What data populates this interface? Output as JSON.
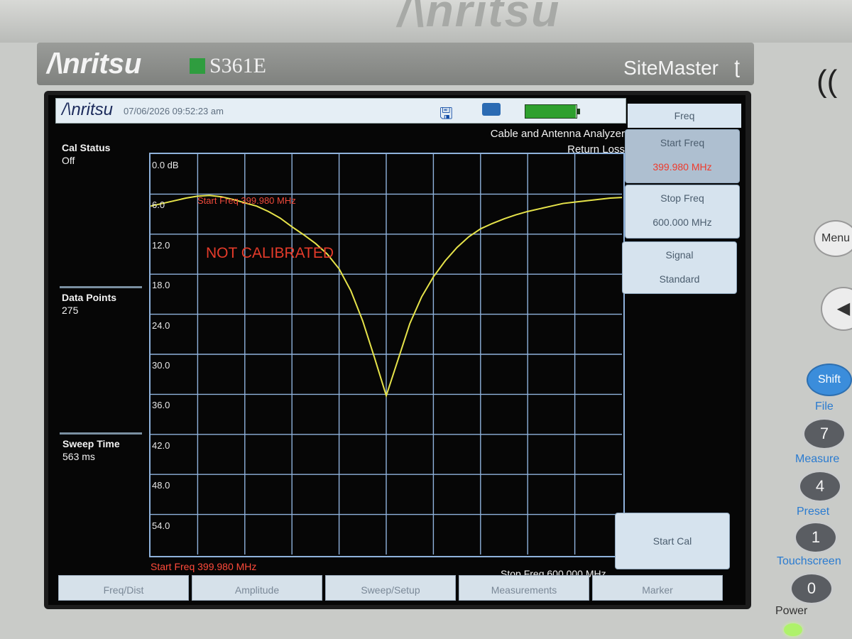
{
  "device": {
    "top_logo": "/\\nritsu",
    "brand": "/\\nritsu",
    "model": "S361E",
    "product": "SiteMaster"
  },
  "status_bar": {
    "logo": "/\\nritsu",
    "datetime": "07/06/2026 09:52:23 am",
    "battery_level": 0.98
  },
  "mode": {
    "line1": "Cable and Antenna Analyzer",
    "line2": "Return Loss"
  },
  "left_panel": {
    "cal_status_label": "Cal Status",
    "cal_status_value": "Off",
    "data_points_label": "Data Points",
    "data_points_value": "275",
    "sweep_time_label": "Sweep Time",
    "sweep_time_value": "563 ms"
  },
  "graph": {
    "y_labels": [
      "0.0 dB",
      "6.0",
      "12.0",
      "18.0",
      "24.0",
      "30.0",
      "36.0",
      "42.0",
      "48.0",
      "54.0"
    ],
    "not_calibrated": "NOT CALIBRATED",
    "marker_label": "Start Freq 399.980 MHz",
    "start_freq_bottom": "Start Freq 399.980 MHz",
    "stop_freq_bottom": "Stop Freq 600.000 MHz"
  },
  "chart_data": {
    "type": "line",
    "title": "Return Loss",
    "xlabel": "",
    "ylabel": "",
    "x_start_mhz": 399.98,
    "x_stop_mhz": 600.0,
    "ylim": [
      0,
      60
    ],
    "y_inverted": true,
    "grid": true,
    "series": [
      {
        "name": "",
        "color": "#e6e34a",
        "x": [
          399.98,
          405,
          410,
          415,
          420,
          425,
          430,
          435,
          440,
          445,
          450,
          455,
          460,
          465,
          470,
          475,
          480,
          485,
          490,
          495,
          500,
          505,
          510,
          515,
          520,
          525,
          530,
          535,
          540,
          545,
          550,
          555,
          560,
          565,
          570,
          575,
          580,
          585,
          590,
          595,
          600
        ],
        "y": [
          7.8,
          7.4,
          7.0,
          6.6,
          6.3,
          6.2,
          6.4,
          6.8,
          7.3,
          7.8,
          8.6,
          9.6,
          10.9,
          12.1,
          13.4,
          15.0,
          17.2,
          20.5,
          25.0,
          30.5,
          36.2,
          30.8,
          25.4,
          21.4,
          18.4,
          16.0,
          14.0,
          12.4,
          11.2,
          10.4,
          9.7,
          9.1,
          8.6,
          8.2,
          7.8,
          7.4,
          7.2,
          7.0,
          6.8,
          6.6,
          6.5
        ]
      }
    ]
  },
  "softkeys": {
    "title": "Freq",
    "start_freq_label": "Start Freq",
    "start_freq_value": "399.980 MHz",
    "stop_freq_label": "Stop Freq",
    "stop_freq_value": "600.000 MHz",
    "signal_label": "Signal",
    "signal_value": "Standard",
    "start_cal": "Start Cal"
  },
  "tabs": [
    "Freq/Dist",
    "Amplitude",
    "Sweep/Setup",
    "Measurements",
    "Marker"
  ],
  "hardware": {
    "menu": "Menu",
    "back": "◀",
    "shift": "Shift",
    "file": "File",
    "key7": "7",
    "measure": "Measure",
    "key4": "4",
    "preset": "Preset",
    "key1": "1",
    "touchscreen": "Touchscreen",
    "key0": "0",
    "power": "Power"
  }
}
